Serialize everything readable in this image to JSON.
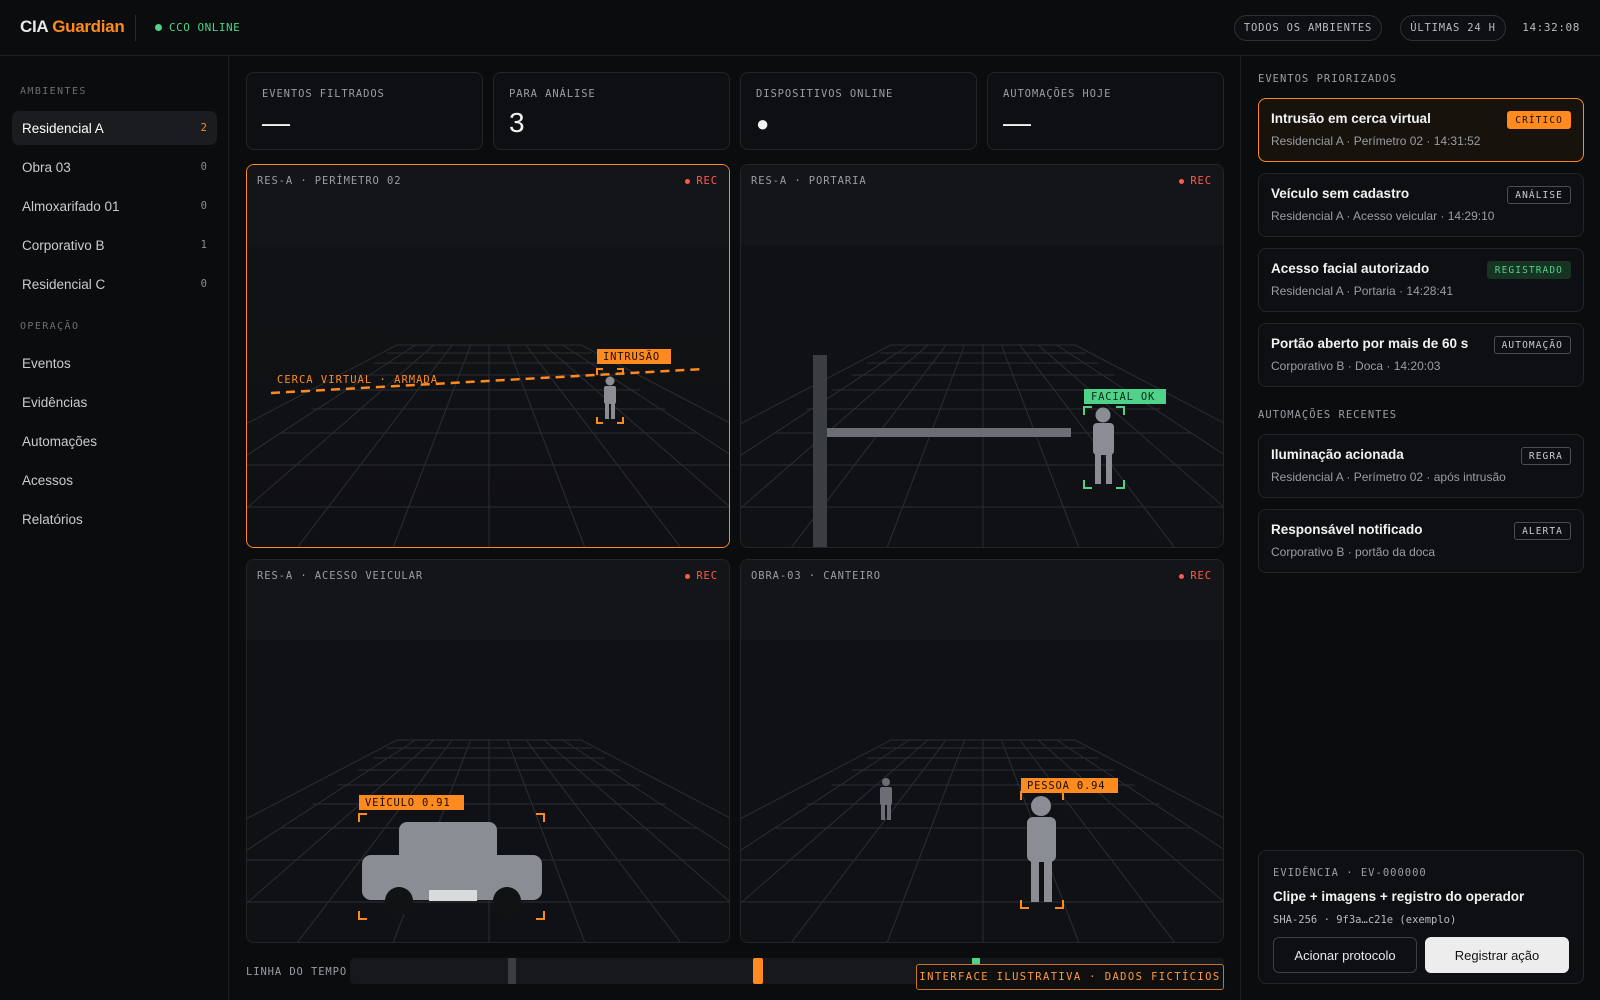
{
  "header": {
    "brand_primary": "CIA",
    "brand_accent": "Guardian",
    "status": "CCO ONLINE",
    "filter_environments": "TODOS OS AMBIENTES",
    "filter_period": "ÚLTIMAS 24 H",
    "clock": "14:32:08"
  },
  "sidebar": {
    "environments_heading": "AMBIENTES",
    "environments": [
      {
        "label": "Residencial A",
        "count": "2"
      },
      {
        "label": "Obra 03",
        "count": "0"
      },
      {
        "label": "Almoxarifado 01",
        "count": "0"
      },
      {
        "label": "Corporativo B",
        "count": "1"
      },
      {
        "label": "Residencial C",
        "count": "0"
      }
    ],
    "operation_heading": "OPERAÇÃO",
    "operation": [
      {
        "label": "Eventos"
      },
      {
        "label": "Evidências"
      },
      {
        "label": "Automações"
      },
      {
        "label": "Acessos"
      },
      {
        "label": "Relatórios"
      }
    ]
  },
  "stats": [
    {
      "label": "EVENTOS FILTRADOS",
      "value": "—"
    },
    {
      "label": "PARA ANÁLISE",
      "value": "3"
    },
    {
      "label": "DISPOSITIVOS ONLINE",
      "value": "●"
    },
    {
      "label": "AUTOMAÇÕES HOJE",
      "value": "—"
    }
  ],
  "cameras": [
    {
      "title": "RES-A · PERÍMETRO 02",
      "rec": "REC",
      "tags": {
        "intrusion": "INTRUSÃO",
        "fence": "CERCA VIRTUAL · ARMADA"
      }
    },
    {
      "title": "RES-A · PORTARIA",
      "rec": "REC",
      "tags": {
        "facial": "FACIAL OK"
      }
    },
    {
      "title": "RES-A · ACESSO VEICULAR",
      "rec": "REC",
      "tags": {
        "vehicle": "VEÍCULO 0.91"
      }
    },
    {
      "title": "OBRA-03 · CANTEIRO",
      "rec": "REC",
      "tags": {
        "person": "PESSOA 0.94"
      }
    }
  ],
  "timeline": {
    "label": "LINHA DO TEMPO",
    "watermark": "INTERFACE ILUSTRATIVA · DADOS FICTÍCIOS"
  },
  "events": {
    "heading": "EVENTOS PRIORIZADOS",
    "items": [
      {
        "title": "Intrusão em cerca virtual",
        "sub": "Residencial A · Perímetro 02 · 14:31:52",
        "badge": "CRÍTICO"
      },
      {
        "title": "Veículo sem cadastro",
        "sub": "Residencial A · Acesso veicular · 14:29:10",
        "badge": "ANÁLISE"
      },
      {
        "title": "Acesso facial autorizado",
        "sub": "Residencial A · Portaria · 14:28:41",
        "badge": "REGISTRADO"
      },
      {
        "title": "Portão aberto por mais de 60 s",
        "sub": "Corporativo B · Doca · 14:20:03",
        "badge": "AUTOMAÇÃO"
      }
    ]
  },
  "automations": {
    "heading": "AUTOMAÇÕES RECENTES",
    "items": [
      {
        "title": "Iluminação acionada",
        "sub": "Residencial A · Perímetro 02 · após intrusão",
        "badge": "REGRA"
      },
      {
        "title": "Responsável notificado",
        "sub": "Corporativo B · portão da doca",
        "badge": "ALERTA"
      }
    ]
  },
  "evidence": {
    "label": "EVIDÊNCIA · EV-000000",
    "title": "Clipe + imagens + registro do operador",
    "hash": "SHA-256 · 9f3a…c21e (exemplo)",
    "primary_action": "Acionar protocolo",
    "secondary_action": "Registrar ação"
  },
  "colors": {
    "accent": "#ff8a1f",
    "online": "#4fd38a",
    "rec": "#ff5b4a",
    "background": "#0b0c0e"
  }
}
